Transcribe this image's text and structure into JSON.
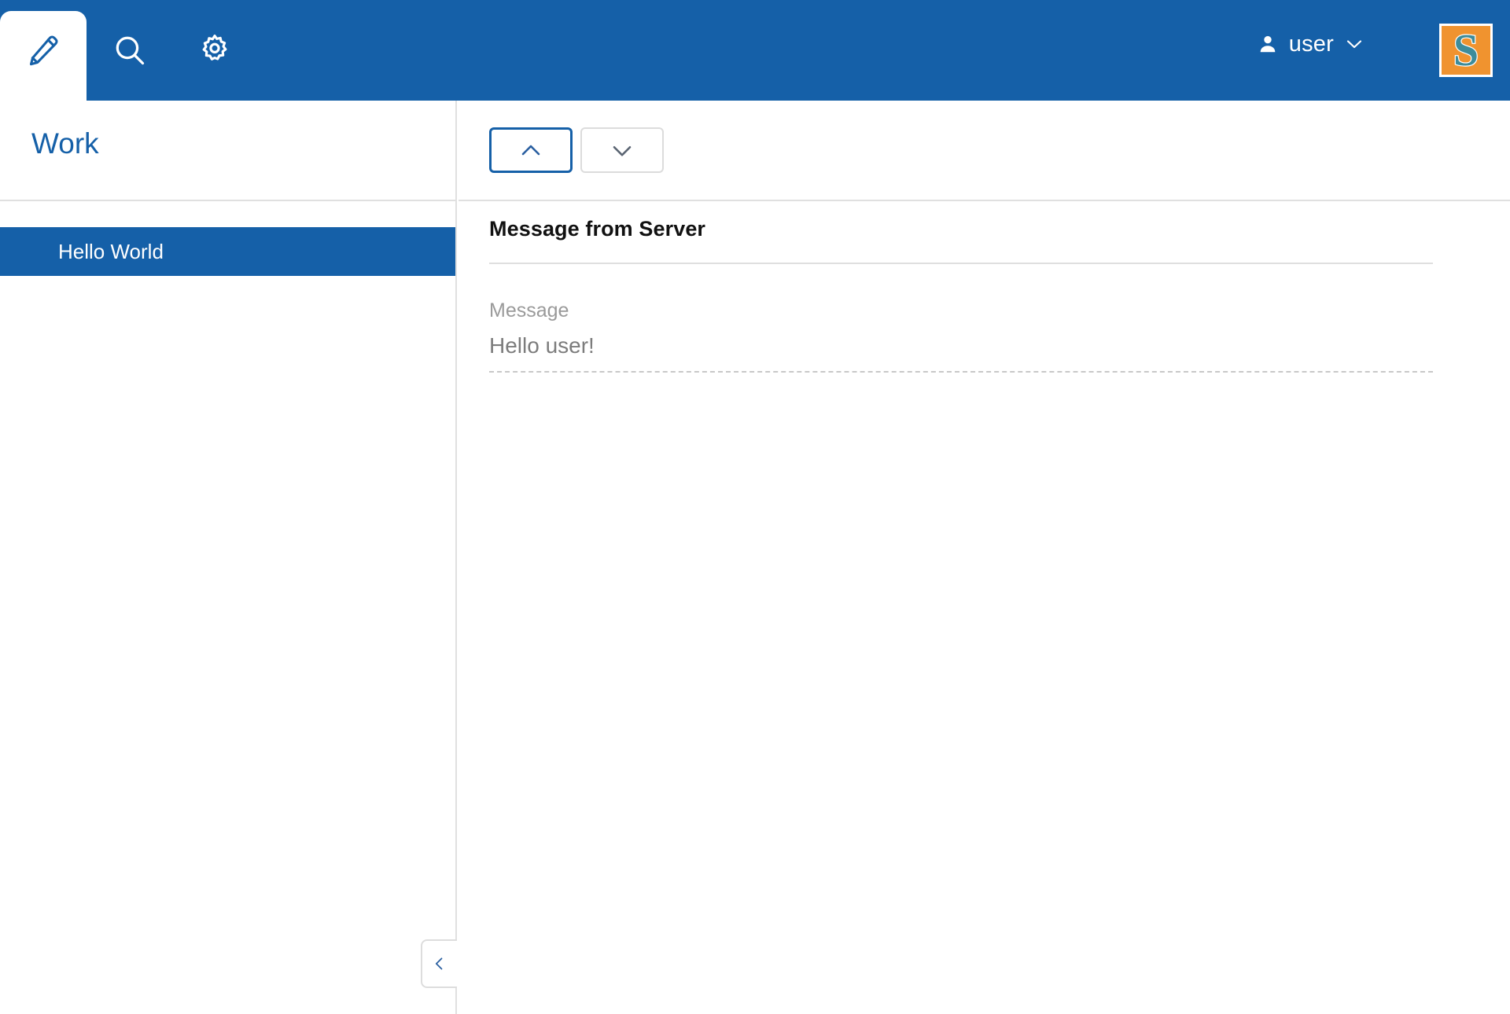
{
  "header": {
    "background_color": "#1560a8",
    "tabs": [
      {
        "id": "edit",
        "icon": "pencil-icon",
        "label": "Edit",
        "active": true
      },
      {
        "id": "search",
        "icon": "search-icon",
        "label": "Search",
        "active": false
      },
      {
        "id": "settings",
        "icon": "gear-icon",
        "label": "Settings",
        "active": false
      }
    ],
    "user": {
      "icon": "person-icon",
      "label": "user",
      "chevron_icon": "chevron-down-icon"
    },
    "logo": {
      "name": "brand-logo",
      "letter": "S",
      "background_color": "#f0932f",
      "letter_color": "#3e8c9a"
    }
  },
  "sidebar": {
    "title": "Work",
    "title_color": "#1560a8",
    "items": [
      {
        "label": "Hello World",
        "selected": true
      }
    ],
    "collapse_button": {
      "icon": "chevron-left-icon",
      "label": "Collapse"
    }
  },
  "main": {
    "toolbar": {
      "prev_button": {
        "icon": "chevron-up-icon",
        "label": "Previous",
        "focused": true
      },
      "next_button": {
        "icon": "chevron-down-icon",
        "label": "Next",
        "focused": false
      }
    },
    "form": {
      "title": "Message from Server",
      "fields": [
        {
          "label": "Message",
          "value": "Hello user!"
        }
      ]
    }
  }
}
